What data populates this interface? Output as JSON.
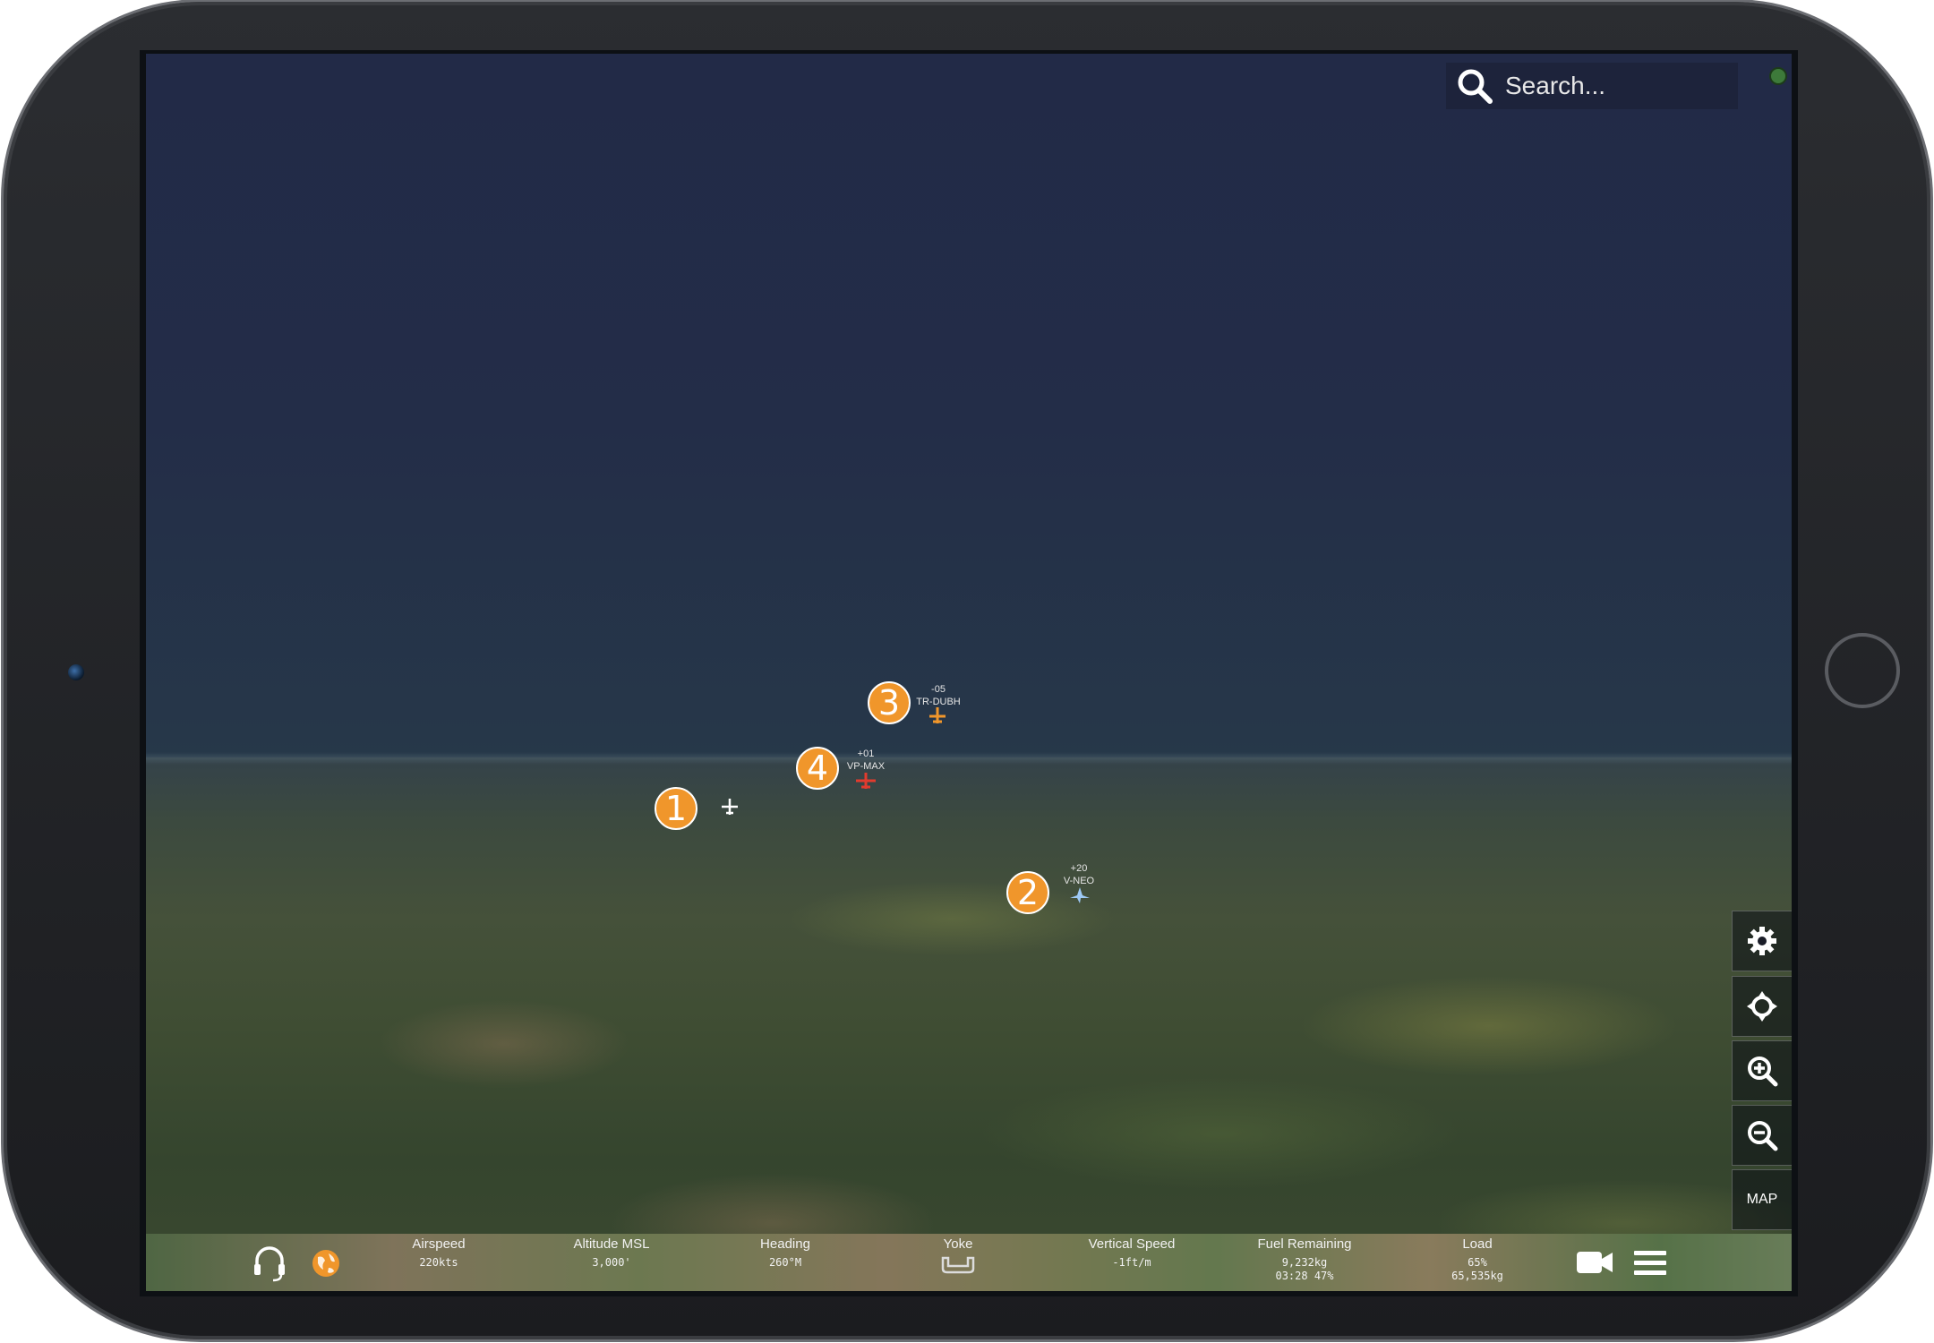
{
  "search": {
    "placeholder": "Search..."
  },
  "markers": [
    {
      "number": "1"
    },
    {
      "number": "2"
    },
    {
      "number": "3"
    },
    {
      "number": "4"
    }
  ],
  "aircraft": [
    {
      "offset": "-05",
      "callsign": "TR-DUBH",
      "color": "#f0962b"
    },
    {
      "offset": "+01",
      "callsign": "VP-MAX",
      "color": "#e23b2e"
    },
    {
      "offset": "+20",
      "callsign": "V-NEO",
      "color": "#9ec9f5"
    },
    {
      "color": "#ffffff"
    }
  ],
  "side_buttons": {
    "settings_icon": "gear-icon",
    "center_icon": "crosshair-icon",
    "zoom_in_icon": "zoom-in-icon",
    "zoom_out_icon": "zoom-out-icon",
    "map_label": "MAP"
  },
  "bottom_bar": {
    "airspeed": {
      "label": "Airspeed",
      "value": "220kts"
    },
    "altitude": {
      "label": "Altitude MSL",
      "value": "3,000'"
    },
    "heading": {
      "label": "Heading",
      "value": "260°M"
    },
    "yoke": {
      "label": "Yoke"
    },
    "vertical_speed": {
      "label": "Vertical Speed",
      "value": "-1ft/m"
    },
    "fuel": {
      "label": "Fuel Remaining",
      "value1": "9,232kg",
      "value2": "03:28 47%"
    },
    "load": {
      "label": "Load",
      "value1": "65%",
      "value2": "65,535kg"
    }
  },
  "colors": {
    "accent": "#f0962b",
    "status_ok": "#3d7a3a"
  }
}
